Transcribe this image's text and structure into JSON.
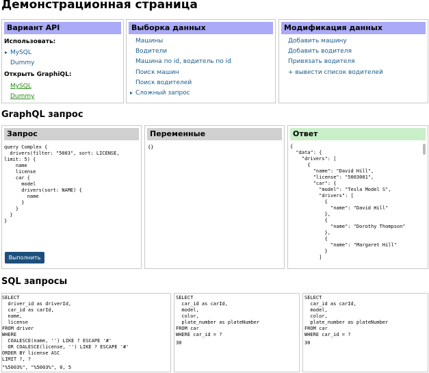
{
  "page": {
    "title": "Демонстрационная страница"
  },
  "api": {
    "header": "Вариант API",
    "use_label": "Использовать:",
    "use_options": [
      "MySQL",
      "Dummy"
    ],
    "graphiql_label": "Открыть GraphiQL:",
    "graphiql_links": [
      "MySQL",
      "Dummy"
    ]
  },
  "select": {
    "header": "Выборка данных",
    "items": [
      "Машины",
      "Водители",
      "Машина по id, водитель по id",
      "Поиск машин",
      "Поиск водителей",
      "Сложный запрос"
    ]
  },
  "modify": {
    "header": "Модификация данных",
    "items": [
      "Добавить машину",
      "Добавить водителя",
      "Привязать водителя",
      "+ вывести список водителей"
    ]
  },
  "graphql": {
    "section_title": "GraphQL запрос",
    "query_header": "Запрос",
    "query_text": "query Complex {\n  drivers(filter: \"5003\", sort: LICENSE,\nlimit: 5) {\n    name\n    license\n    car {\n      model\n      drivers(sort: NAME) {\n        name\n      }\n    }\n  }\n}",
    "run_label": "Выполнить",
    "vars_header": "Переменные",
    "vars_text": "{}",
    "answer_header": "Ответ",
    "answer_text": "{\n  \"data\": {\n    \"drivers\": [\n      {\n        \"name\": \"David Hill\",\n        \"license\": \"5003001\",\n        \"car\": {\n          \"model\": \"Tesla Model S\",\n          \"drivers\": [\n            {\n              \"name\": \"David Hill\"\n            },\n            {\n              \"name\": \"Dorothy Thompson\"\n            },\n            {\n              \"name\": \"Margaret Hill\"\n            }\n          ]"
  },
  "sql": {
    "section_title": "SQL запросы",
    "queries": [
      "SELECT\n  driver_id as driverId,\n  car_id as carId,\n  name,\n  license\nFROM driver\nWHERE\n  COALESCE(name, '') LIKE ? ESCAPE '#'\n  OR COALESCE(license, '') LIKE ? ESCAPE '#'\nORDER BY license ASC\nLIMIT ?, ?",
      "SELECT\n  car_id as carId,\n  model,\n  color,\n  plate_number as plateNumber\nFROM car\nWHERE car_id = ?",
      "SELECT\n  car_id as carId,\n  model,\n  color,\n  plate_number as plateNumber\nFROM car\nWHERE car_id = ?"
    ],
    "params": [
      "\"%5003%\", \"%5003%\", 0, 5",
      "30",
      "30"
    ]
  }
}
